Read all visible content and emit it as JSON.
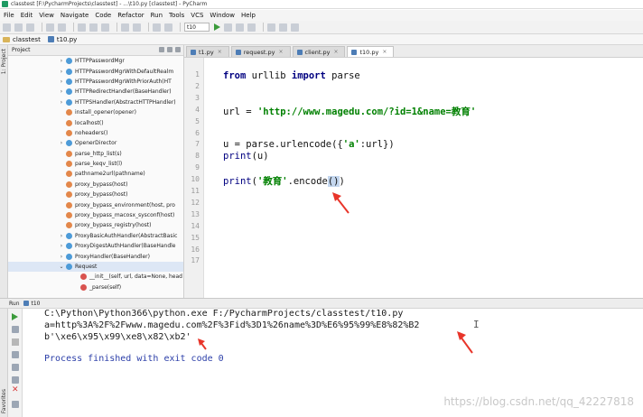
{
  "window": {
    "title": "classtest [F:\\PycharmProjects\\classtest] - ...\\t10.py [classtest] - PyCharm"
  },
  "menu": [
    "File",
    "Edit",
    "View",
    "Navigate",
    "Code",
    "Refactor",
    "Run",
    "Tools",
    "VCS",
    "Window",
    "Help"
  ],
  "toolbar": {
    "run_config": "t10"
  },
  "breadcrumb": {
    "project": "classtest",
    "file": "t10.py"
  },
  "project_panel": {
    "tool_window_label": "1: Project",
    "header": "Project",
    "items": [
      {
        "label": "HTTPPasswordMgr",
        "kind": "c",
        "expand": "›"
      },
      {
        "label": "HTTPPasswordMgrWithDefaultRealm",
        "kind": "c",
        "expand": "›"
      },
      {
        "label": "HTTPPasswordMgrWithPriorAuth(HT",
        "kind": "c",
        "expand": "›"
      },
      {
        "label": "HTTPRedirectHandler(BaseHandler)",
        "kind": "c",
        "expand": "›"
      },
      {
        "label": "HTTPSHandler(AbstractHTTPHandler)",
        "kind": "c",
        "expand": "›"
      },
      {
        "label": "install_opener(opener)",
        "kind": "f",
        "expand": ""
      },
      {
        "label": "localhost()",
        "kind": "f",
        "expand": ""
      },
      {
        "label": "noheaders()",
        "kind": "f",
        "expand": ""
      },
      {
        "label": "OpenerDirector",
        "kind": "c",
        "expand": "›"
      },
      {
        "label": "parse_http_list(s)",
        "kind": "f",
        "expand": ""
      },
      {
        "label": "parse_keqv_list(l)",
        "kind": "f",
        "expand": ""
      },
      {
        "label": "pathname2url(pathname)",
        "kind": "f",
        "expand": ""
      },
      {
        "label": "proxy_bypass(host)",
        "kind": "f",
        "expand": ""
      },
      {
        "label": "proxy_bypass(host)",
        "kind": "f",
        "expand": ""
      },
      {
        "label": "proxy_bypass_environment(host, pro",
        "kind": "f",
        "expand": ""
      },
      {
        "label": "proxy_bypass_macosx_sysconf(host)",
        "kind": "f",
        "expand": ""
      },
      {
        "label": "proxy_bypass_registry(host)",
        "kind": "f",
        "expand": ""
      },
      {
        "label": "ProxyBasicAuthHandler(AbstractBasic",
        "kind": "c",
        "expand": "›"
      },
      {
        "label": "ProxyDigestAuthHandler(BaseHandle",
        "kind": "c",
        "expand": "›"
      },
      {
        "label": "ProxyHandler(BaseHandler)",
        "kind": "c",
        "expand": "›"
      },
      {
        "label": "Request",
        "kind": "c",
        "expand": "⌄"
      },
      {
        "label": "__init__(self, url, data=None, head",
        "kind": "m",
        "expand": ""
      },
      {
        "label": "_parse(self)",
        "kind": "m",
        "expand": ""
      }
    ]
  },
  "editor": {
    "tabs": [
      {
        "label": "t1.py",
        "active": false
      },
      {
        "label": "request.py",
        "active": false
      },
      {
        "label": "client.py",
        "active": false
      },
      {
        "label": "t10.py",
        "active": true
      }
    ],
    "line_numbers": [
      "1",
      "2",
      "3",
      "4",
      "5",
      "6",
      "7",
      "8",
      "9",
      "10",
      "11",
      "12",
      "13",
      "14",
      "15",
      "16",
      "17"
    ],
    "code": {
      "line1_kw1": "from",
      "line1_mod": " urllib ",
      "line1_kw2": "import",
      "line1_name": " parse",
      "line4_pre": "url = ",
      "line4_str": "'http://www.magedu.com/?id=1&name=教育'",
      "line7_pre": "u = parse.urlencode({",
      "line7_str": "'a'",
      "line7_post": ":url})",
      "line8_fn": "print",
      "line8_args": "(u)",
      "line10_fn": "print",
      "line10_open": "(",
      "line10_str": "'教育'",
      "line10_method": ".encode",
      "line10_call": "()",
      "line10_close": ")"
    }
  },
  "run_panel": {
    "label": "Run",
    "config": "t10",
    "strip_label": "Favorites",
    "output": {
      "command": "C:\\Python\\Python366\\python.exe F:/PycharmProjects/classtest/t10.py",
      "line1": "a=http%3A%2F%2Fwww.magedu.com%2F%3Fid%3D1%26name%3D%E6%95%99%E8%82%B2",
      "line2": "b'\\xe6\\x95\\x99\\xe8\\x82\\xb2'",
      "exit": "Process finished with exit code 0"
    }
  },
  "watermark": "https://blog.csdn.net/qq_42227818",
  "colors": {
    "keyword": "#000080",
    "string": "#008000",
    "arrow": "#e8352a"
  }
}
